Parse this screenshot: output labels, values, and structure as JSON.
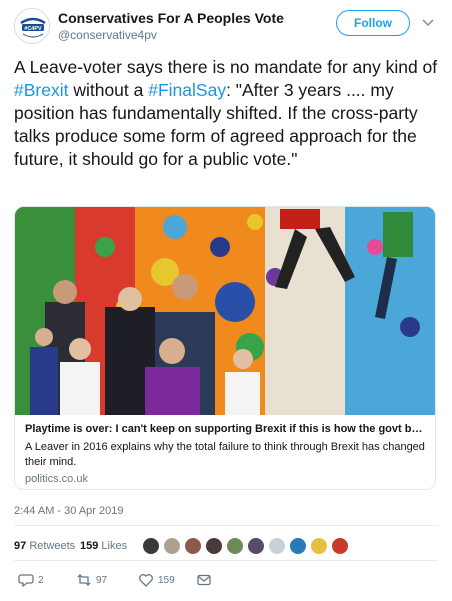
{
  "header": {
    "display_name": "Conservatives For A Peoples Vote",
    "handle": "@conservative4pv",
    "follow_label": "Follow",
    "avatar_text": "#C4PV"
  },
  "tweet": {
    "parts": [
      {
        "text": "A Leave-voter says there is no mandate for any kind of ",
        "hashtag": false
      },
      {
        "text": "#Brexit",
        "hashtag": true
      },
      {
        "text": " without a ",
        "hashtag": false
      },
      {
        "text": "#FinalSay",
        "hashtag": true
      },
      {
        "text": ": \"After 3 years .... my position has fundamentally shifted. If the cross-party talks produce some form of agreed approach for the future, it should go for a public vote.\"",
        "hashtag": false
      }
    ]
  },
  "card": {
    "title": "Playtime is over: I can't keep on supporting Brexit if this is how the govt beha...",
    "description": "A Leaver in 2016 explains why the total failure to think through Brexit has changed their mind.",
    "domain": "politics.co.uk"
  },
  "timestamp": "2:44 AM - 30 Apr 2019",
  "stats": {
    "retweets_count": "97",
    "retweets_label": "Retweets",
    "likes_count": "159",
    "likes_label": "Likes"
  },
  "actions": {
    "reply_count": "2",
    "retweet_count": "97",
    "like_count": "159"
  },
  "colors": {
    "accent": "#1da1f2",
    "hashtag": "#1b95e0",
    "muted": "#657786"
  }
}
